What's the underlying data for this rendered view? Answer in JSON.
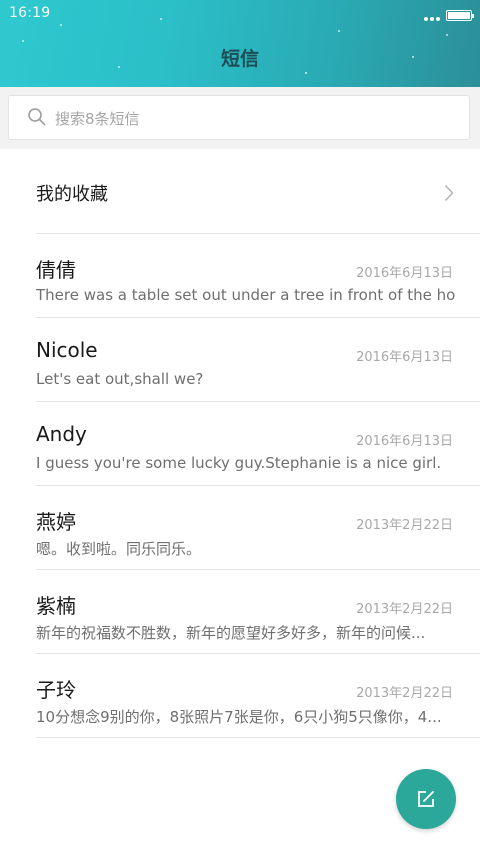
{
  "status_bar": {
    "time": "16:19"
  },
  "header": {
    "title": "短信"
  },
  "search": {
    "placeholder": "搜索8条短信"
  },
  "favorites": {
    "label": "我的收藏"
  },
  "messages": [
    {
      "name": "倩倩",
      "date": "2016年6月13日",
      "preview": "There was a table set out under a tree in front of the ho.."
    },
    {
      "name": "Nicole",
      "date": "2016年6月13日",
      "preview": "Let's eat out,shall we?"
    },
    {
      "name": "Andy",
      "date": "2016年6月13日",
      "preview": "I guess you're some lucky guy.Stephanie is a nice girl."
    },
    {
      "name": "燕婷",
      "date": "2013年2月22日",
      "preview": "嗯。收到啦。同乐同乐。"
    },
    {
      "name": "紫楠",
      "date": "2013年2月22日",
      "preview": "新年的祝福数不胜数，新年的愿望好多好多，新年的问候..."
    },
    {
      "name": "子玲",
      "date": "2013年2月22日",
      "preview": "10分想念9别的你，8张照片7张是你，6只小狗5只像你，4..."
    }
  ],
  "fab": {
    "icon": "compose-icon",
    "color": "#2ca89a"
  },
  "colors": {
    "header_teal": "#2ec9cf",
    "accent": "#2ca89a"
  }
}
